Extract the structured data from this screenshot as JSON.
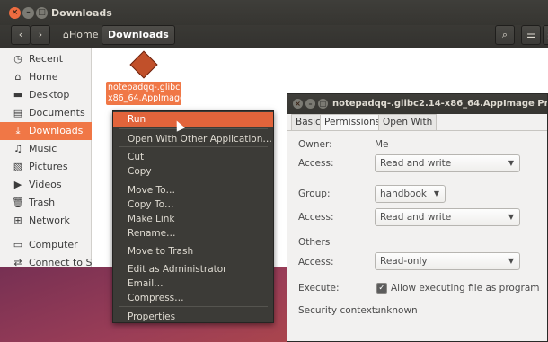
{
  "files_window": {
    "title": "Downloads",
    "breadcrumb": {
      "home": "Home",
      "current": "Downloads"
    },
    "sidebar": [
      {
        "label": "Recent",
        "icon": "recent-icon"
      },
      {
        "label": "Home",
        "icon": "home-icon"
      },
      {
        "label": "Desktop",
        "icon": "desktop-icon"
      },
      {
        "label": "Documents",
        "icon": "documents-icon"
      },
      {
        "label": "Downloads",
        "icon": "downloads-icon",
        "active": true
      },
      {
        "label": "Music",
        "icon": "music-icon"
      },
      {
        "label": "Pictures",
        "icon": "pictures-icon"
      },
      {
        "label": "Videos",
        "icon": "videos-icon"
      },
      {
        "label": "Trash",
        "icon": "trash-icon"
      },
      {
        "label": "Network",
        "icon": "network-icon"
      },
      {
        "label": "Computer",
        "icon": "computer-icon"
      },
      {
        "label": "Connect to S…",
        "icon": "connect-server-icon"
      }
    ],
    "file": {
      "name": "notepadqq-.glibc2.14-x86_64.AppImage"
    }
  },
  "context_menu": {
    "items": [
      "Run",
      "Open With Other Application…",
      "Cut",
      "Copy",
      "Move To…",
      "Copy To…",
      "Make Link",
      "Rename…",
      "Move to Trash",
      "Edit as Administrator",
      "Email…",
      "Compress…",
      "Properties"
    ],
    "active_item": "Run"
  },
  "properties_dialog": {
    "title": "notepadqq-.glibc2.14-x86_64.AppImage Prope",
    "tabs": [
      "Basic",
      "Permissions",
      "Open With"
    ],
    "active_tab": "Permissions",
    "owner_label": "Owner:",
    "owner_value": "Me",
    "access_label": "Access:",
    "owner_access": "Read and write",
    "group_label": "Group:",
    "group_value": "handbook",
    "group_access": "Read and write",
    "others_label": "Others",
    "others_access": "Read-only",
    "execute_label": "Execute:",
    "execute_checkbox_label": "Allow executing file as program",
    "execute_checked": true,
    "security_label": "Security context:",
    "security_value": "unknown"
  },
  "status_fragment": "ME",
  "colors": {
    "accent": "#f07746",
    "menu_bg": "#3c3b37",
    "titlebar": "#3c3b37"
  }
}
